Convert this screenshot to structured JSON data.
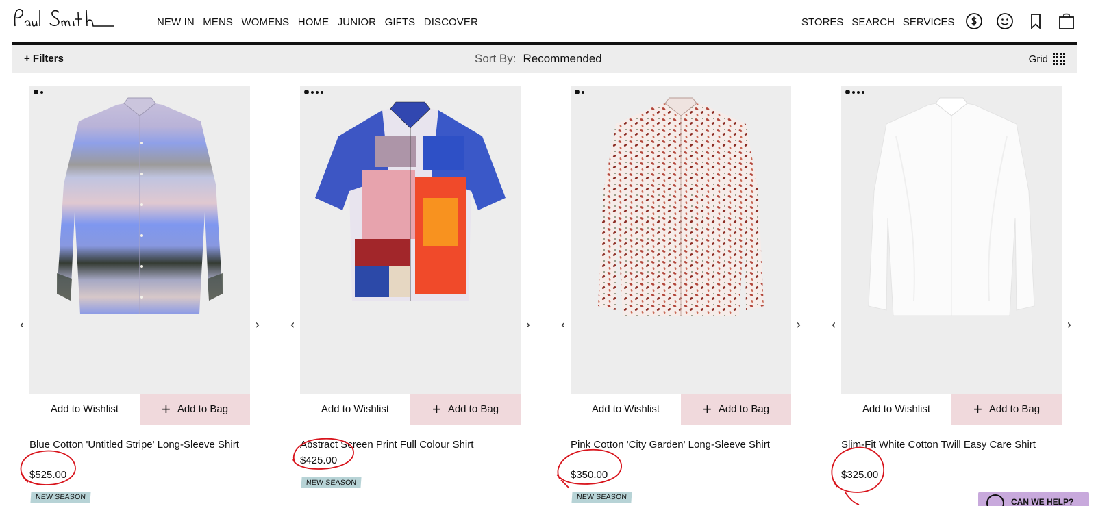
{
  "brand": "Paul Smith",
  "nav": {
    "items": [
      "NEW IN",
      "MENS",
      "WOMENS",
      "HOME",
      "JUNIOR",
      "GIFTS",
      "DISCOVER"
    ],
    "utility": [
      "STORES",
      "SEARCH",
      "SERVICES"
    ]
  },
  "header_icons": [
    "currency-dollar-icon",
    "account-smiley-icon",
    "wishlist-bookmark-icon",
    "bag-icon"
  ],
  "toolbar": {
    "filters": "+ Filters",
    "sort_label": "Sort By:",
    "sort_value": "Recommended",
    "view_label": "Grid"
  },
  "buttons": {
    "wishlist": "Add to Wishlist",
    "bag": "Add to Bag"
  },
  "products": [
    {
      "name": "Blue Cotton 'Untitled Stripe' Long-Sleeve Shirt",
      "price": "$525.00",
      "badge": "NEW SEASON",
      "image_count": 2,
      "price_circled": true
    },
    {
      "name": "Abstract Screen Print Full Colour Shirt",
      "price": "$425.00",
      "badge": "NEW SEASON",
      "image_count": 4,
      "price_circled": true
    },
    {
      "name": "Pink Cotton 'City Garden' Long-Sleeve Shirt",
      "price": "$350.00",
      "badge": "NEW SEASON",
      "image_count": 2,
      "price_circled": true
    },
    {
      "name": "Slim-Fit White Cotton Twill Easy Care Shirt",
      "price": "$325.00",
      "badge": "",
      "image_count": 4,
      "price_circled": true
    }
  ],
  "help": "CAN WE HELP?",
  "colors": {
    "accent_pink": "#f0d9dc",
    "badge_blue": "#b7d3d6",
    "annotation_red": "#d8141c",
    "help_purple": "#c8a9dc"
  }
}
